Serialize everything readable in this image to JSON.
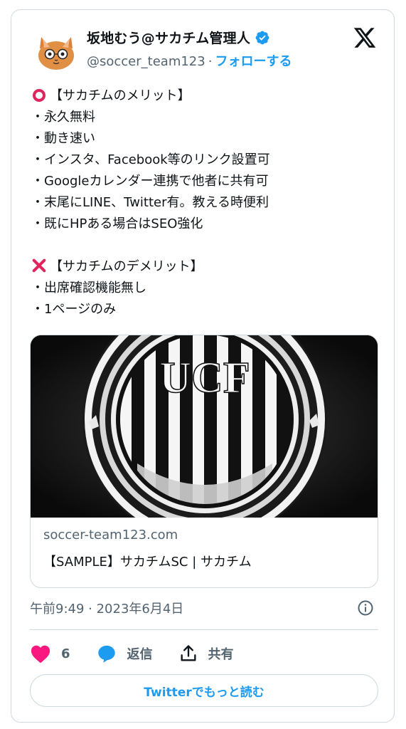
{
  "author": {
    "display_name": "坂地むう@サカチム管理人",
    "handle": "@soccer_team123",
    "separator": "·",
    "follow_label": "フォローする",
    "verified": true,
    "avatar_icon": "cat-avatar-icon"
  },
  "brand_icon": "x-logo-icon",
  "tweet": {
    "merit_heading": "【サカチムのメリット】",
    "merits": [
      "・永久無料",
      "・動き速い",
      "・インスタ、Facebook等のリンク設置可",
      "・Googleカレンダー連携で他者に共有可",
      "・末尾にLINE、Twitter有。教える時便利",
      "・既にHPある場合はSEO強化"
    ],
    "demerit_heading": "【サカチムのデメリット】",
    "demerits": [
      "・出席確認機能無し",
      "・1ページのみ"
    ]
  },
  "link_card": {
    "image_text": "UCF",
    "domain": "soccer-team123.com",
    "title": "【SAMPLE】サカチムSC | サカチム"
  },
  "timestamp": "午前9:49 · 2023年6月4日",
  "actions": {
    "like_count": "6",
    "reply_label": "返信",
    "share_label": "共有"
  },
  "read_more_label": "Twitterでもっと読む",
  "colors": {
    "accent": "#1d9bf0",
    "like": "#f91880",
    "text": "#0f1419",
    "muted": "#536471",
    "border": "#cfd9de"
  }
}
